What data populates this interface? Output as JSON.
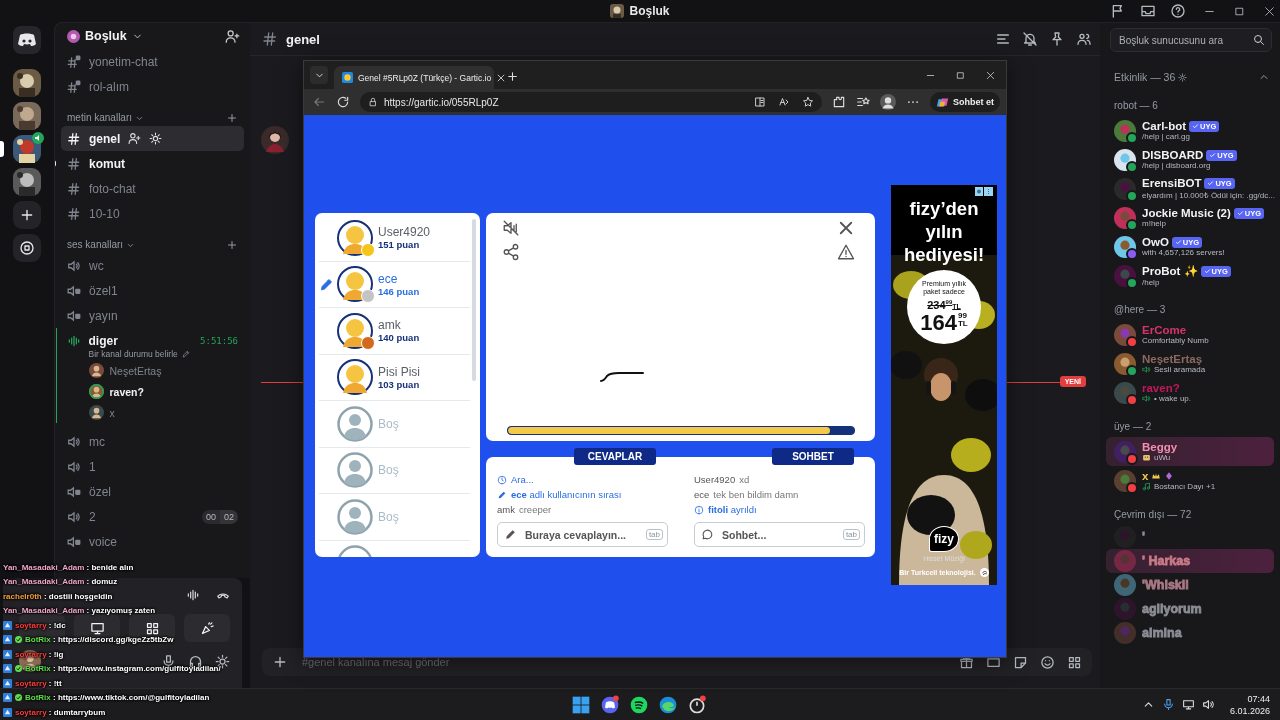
{
  "title_bar": {
    "title": "Boşluk"
  },
  "servers": [
    {
      "selected": false,
      "voice": false
    },
    {
      "selected": false,
      "voice": false
    },
    {
      "selected": true,
      "voice": true
    },
    {
      "selected": false,
      "voice": false
    }
  ],
  "server_header": {
    "name": "Boşluk"
  },
  "channels": [
    {
      "kind": "text",
      "name": "yonetim-chat",
      "locked": true,
      "selected": false,
      "unread": false
    },
    {
      "kind": "text",
      "name": "rol-alım",
      "locked": true,
      "selected": false,
      "unread": false
    },
    {
      "kind": "category",
      "name": "metin kanalları"
    },
    {
      "kind": "text",
      "name": "genel",
      "locked": false,
      "selected": true,
      "unread": false
    },
    {
      "kind": "text",
      "name": "komut",
      "locked": false,
      "selected": false,
      "unread": true
    },
    {
      "kind": "text",
      "name": "foto-chat",
      "locked": false,
      "selected": false,
      "unread": false
    },
    {
      "kind": "text",
      "name": "10-10",
      "locked": false,
      "selected": false,
      "unread": false
    },
    {
      "kind": "category",
      "name": "ses kanalları"
    },
    {
      "kind": "voice",
      "name": "wc",
      "locked": false,
      "active": false
    },
    {
      "kind": "voice",
      "name": "özel1",
      "locked": true,
      "active": false
    },
    {
      "kind": "voice",
      "name": "yayın",
      "locked": true,
      "active": false
    },
    {
      "kind": "voice",
      "name": "diger",
      "active": true,
      "timer": "5:51:56",
      "status": "Bir kanal durumu belirle",
      "users": [
        {
          "name": "NeşetErtaş",
          "speaking": false
        },
        {
          "name": "raven?",
          "speaking": true
        },
        {
          "name": "x",
          "speaking": false
        }
      ]
    },
    {
      "kind": "voice",
      "name": "mc",
      "locked": false,
      "active": false
    },
    {
      "kind": "voice",
      "name": "1",
      "locked": false,
      "active": false
    },
    {
      "kind": "voice",
      "name": "özel",
      "locked": true,
      "active": false
    },
    {
      "kind": "voice",
      "name": "2",
      "locked": false,
      "active": false,
      "counts": [
        "00",
        "02"
      ]
    },
    {
      "kind": "voice",
      "name": "voice",
      "locked": true,
      "active": false
    }
  ],
  "main": {
    "channel": "genel",
    "new_marker": "YENİ",
    "composer_placeholder": "#genel kanalına mesaj gönder"
  },
  "search": {
    "placeholder": "Boşluk sunucusunu ara"
  },
  "browser": {
    "tab_title": "Genel #5RLp0Z (Türkçe) - Gartic.io",
    "url": "https://gartic.io/055RLp0Z",
    "copilot_label": "Sohbet et"
  },
  "game": {
    "players": [
      {
        "kind": "player",
        "name": "User4920",
        "points": "151 puan",
        "drawing": false,
        "color": "#f5c518"
      },
      {
        "kind": "player",
        "name": "ece",
        "points": "146 puan",
        "drawing": true,
        "color": "#c4c4c4"
      },
      {
        "kind": "player",
        "name": "amk",
        "points": "140 puan",
        "drawing": false,
        "color": "#d2691e"
      },
      {
        "kind": "player",
        "name": "Pisi Pisi",
        "points": "103 puan",
        "drawing": false
      },
      {
        "kind": "empty",
        "name": "Boş"
      },
      {
        "kind": "empty",
        "name": "Boş"
      },
      {
        "kind": "empty",
        "name": "Boş"
      }
    ],
    "timer": {
      "level": 0.93
    },
    "answers_label": "CEVAPLAR",
    "chat_label": "SOHBET",
    "answers": [
      {
        "kind": "info",
        "text": "Ara..."
      },
      {
        "kind": "turn",
        "text": "**ece** adlı kullanıcının sırası"
      },
      {
        "kind": "message",
        "user": "amk",
        "text": "creeper"
      }
    ],
    "answer_input": {
      "placeholder": "Buraya cevaplayın...",
      "key": "tab"
    },
    "chat": [
      {
        "kind": "message",
        "user": "User4920",
        "text": "xd"
      },
      {
        "kind": "message",
        "user": "ece",
        "text": "tek ben bildim damn"
      },
      {
        "kind": "leave",
        "text": "**fitoli** ayrıldı"
      }
    ],
    "chat_input": {
      "placeholder": "Sohbet...",
      "key": "tab"
    }
  },
  "ad": {
    "headline": "fizy’den yılın hediyesi!",
    "offer": "Premium yıllık paket sadece",
    "old_price": "234",
    "old_cents": "99",
    "old_currency": "TL",
    "price": "164",
    "cents": "99",
    "currency": "TL",
    "brand": "fizy",
    "slogan": "Hisset Müziği",
    "footer": "Bir Turkcell teknolojisi."
  },
  "members": {
    "header": "Etkinlik — 36",
    "groups": [
      {
        "title": "robot — 6",
        "members": [
          {
            "kind": "plain",
            "name": "Carl-bot",
            "activity": "/help | carl.gg",
            "status": {
              "color": "#23a55a"
            },
            "badge": "UYG",
            "color": "#f2f3f5"
          },
          {
            "kind": "plain",
            "name": "DISBOARD",
            "activity": "/help | disboard.org",
            "status": {
              "color": "#23a55a"
            },
            "badge": "UYG",
            "color": "#f2f3f5"
          },
          {
            "kind": "plain",
            "name": "ErensiBOT",
            "activity": "elyardım | 10.000₺ Ödül için: .gg/dc...",
            "status": {
              "color": "#23a55a"
            },
            "badge": "UYG",
            "color": "#f2f3f5"
          },
          {
            "kind": "plain",
            "name": "Jockie Music (2)",
            "activity": "m!help",
            "status": {
              "color": "#23a55a"
            },
            "badge": "UYG",
            "color": "#f2f3f5"
          },
          {
            "kind": "plain",
            "name": "OwO",
            "activity": "with 4,657,126 servers!",
            "status": {
              "color": "#8a5cf6"
            },
            "badge": "UYG",
            "color": "#f2f3f5"
          },
          {
            "kind": "plain",
            "name": "ProBot ✨",
            "activity": "/help",
            "status": {
              "color": "#23a55a"
            },
            "badge": "UYG",
            "color": "#f2f3f5"
          }
        ]
      },
      {
        "title": "@here — 3",
        "members": [
          {
            "kind": "plain",
            "name": "ErCome",
            "activity": "Comfortably Numb",
            "status": {
              "color": "#f23f43"
            },
            "color": "#d6336c"
          },
          {
            "kind": "voice",
            "name": "NeşetErtaş",
            "activity": "Sesli aramada",
            "status": {
              "color": "#23a55a"
            },
            "color": "#8a6a60"
          },
          {
            "kind": "voice",
            "name": "raven?",
            "activity": "• wake up.",
            "status": {
              "color": "#f23f43"
            },
            "color": "#c2185b"
          }
        ]
      },
      {
        "title": "üye — 2",
        "members": [
          {
            "kind": "emoji",
            "name": "Beggy",
            "activity": "uWu",
            "status": {
              "color": "#f23f43"
            },
            "color": "#f48fb1",
            "highlight": true
          },
          {
            "kind": "music",
            "name": "x",
            "activity": "Bostancı Dayı +1",
            "status": {
              "color": "#f23f43"
            },
            "color": "#f2c94c",
            "decorated": true
          }
        ]
      },
      {
        "title": "Çevrim dışı — 72",
        "members": [
          {
            "kind": "offline",
            "name": "'",
            "color": "#8b8d94"
          },
          {
            "kind": "offline",
            "name": "' Harkas",
            "color": "#c97a88",
            "highlight": true
          },
          {
            "kind": "offline",
            "name": "'Whiskii",
            "color": "#a87884"
          },
          {
            "kind": "offline",
            "name": "agliyorum",
            "color": "#8b8d94"
          },
          {
            "kind": "offline",
            "name": "almina",
            "color": "#8b8d94"
          }
        ]
      }
    ]
  },
  "overlay_chat": [
    {
      "platform": false,
      "user": "Yan_Masadaki_Adam",
      "color": "#f0a6c8",
      "verified": false,
      "text": ": benide alın"
    },
    {
      "platform": false,
      "user": "Yan_Masadaki_Adam",
      "color": "#f0a6c8",
      "verified": false,
      "text": ": domuz"
    },
    {
      "platform": false,
      "user": "racheIr0th",
      "color": "#f0a040",
      "verified": false,
      "text": ": dostiii hoşgeldin"
    },
    {
      "platform": false,
      "user": "Yan_Masadaki_Adam",
      "color": "#f0a6c8",
      "verified": false,
      "text": ": yazıyomuş zaten"
    },
    {
      "platform": true,
      "user": "soytarry",
      "color": "#ff3b3b",
      "verified": false,
      "text": ": !dc"
    },
    {
      "platform": true,
      "user": "BotRix",
      "color": "#5ee04a",
      "verified": true,
      "text": ": https://discord.gg/kgeZz5tbZw"
    },
    {
      "platform": true,
      "user": "soytarry",
      "color": "#ff3b3b",
      "verified": false,
      "text": ": !ig"
    },
    {
      "platform": true,
      "user": "BotRix",
      "color": "#5ee04a",
      "verified": true,
      "text": ": https://www.instagram.com/gulfitoyladilan/"
    },
    {
      "platform": true,
      "user": "soytarry",
      "color": "#ff3b3b",
      "verified": false,
      "text": ": !tt"
    },
    {
      "platform": true,
      "user": "BotRix",
      "color": "#5ee04a",
      "verified": true,
      "text": ": https://www.tiktok.com/@gulfitoyladilan"
    },
    {
      "platform": true,
      "user": "soytarry",
      "color": "#ff3b3b",
      "verified": false,
      "text": ": dumtarrybum"
    }
  ],
  "taskbar": {
    "time": "07:44",
    "date": "6.01.2026"
  }
}
